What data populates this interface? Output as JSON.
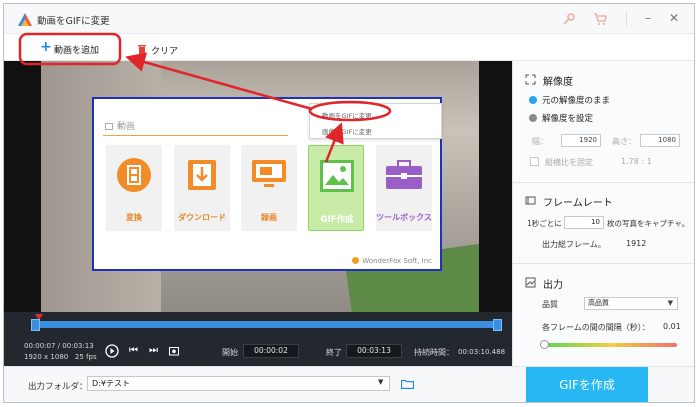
{
  "window": {
    "title": "動画をGIFに変更"
  },
  "toolbar": {
    "add_label": "動画を追加",
    "clear_label": "クリア"
  },
  "inset": {
    "section_label": "動画",
    "dropdown_items": [
      "動画をGIFに変更",
      "画像をGIFに変更"
    ],
    "tiles": [
      {
        "label": "変換",
        "icon": "film-icon"
      },
      {
        "label": "ダウンロード",
        "icon": "download-icon"
      },
      {
        "label": "録画",
        "icon": "monitor-icon"
      },
      {
        "label": "GIF作成",
        "icon": "image-icon"
      },
      {
        "label": "ツールボックス",
        "icon": "toolbox-icon"
      }
    ],
    "brand": "WonderFox Soft, Inc"
  },
  "player": {
    "position": "00:00:07",
    "duration": "00:03:13",
    "resolution": "1920 x 1080",
    "fps": "25 fps",
    "start_label": "開始",
    "start_value": "00:00:02",
    "end_label": "終了",
    "end_value": "00:03:13",
    "duration_label": "持続時間：",
    "duration_value": "00:03:10.488"
  },
  "output": {
    "label": "出力フォルダ：",
    "path": "D:¥テスト"
  },
  "convert_label": "GIFを作成",
  "resolution": {
    "title": "解像度",
    "option_keep": "元の解像度のまま",
    "option_set": "解像度を設定",
    "width_label": "幅：",
    "width_value": "1920",
    "height_label": "高さ：",
    "height_value": "1080",
    "aspect_label": "縦横比を固定",
    "aspect_value": "1.78 : 1"
  },
  "framerate": {
    "title": "フレームレート",
    "prefix": "1秒ごとに",
    "value": "10",
    "suffix": "枚の写真をキャプチャ。",
    "total_label": "出力総フレーム。",
    "total_value": "1912"
  },
  "output_settings": {
    "title": "出力",
    "quality_label": "品質",
    "quality_value": "高品質",
    "interval_label": "各フレームの間の間隔（秒）：",
    "interval_value": "0.01",
    "interval_slider_fraction": 0.0
  },
  "colors": {
    "accent": "#27b8f3",
    "orange": "#f28c28",
    "annotation": "#e0262a",
    "inset_border": "#2033b8"
  }
}
